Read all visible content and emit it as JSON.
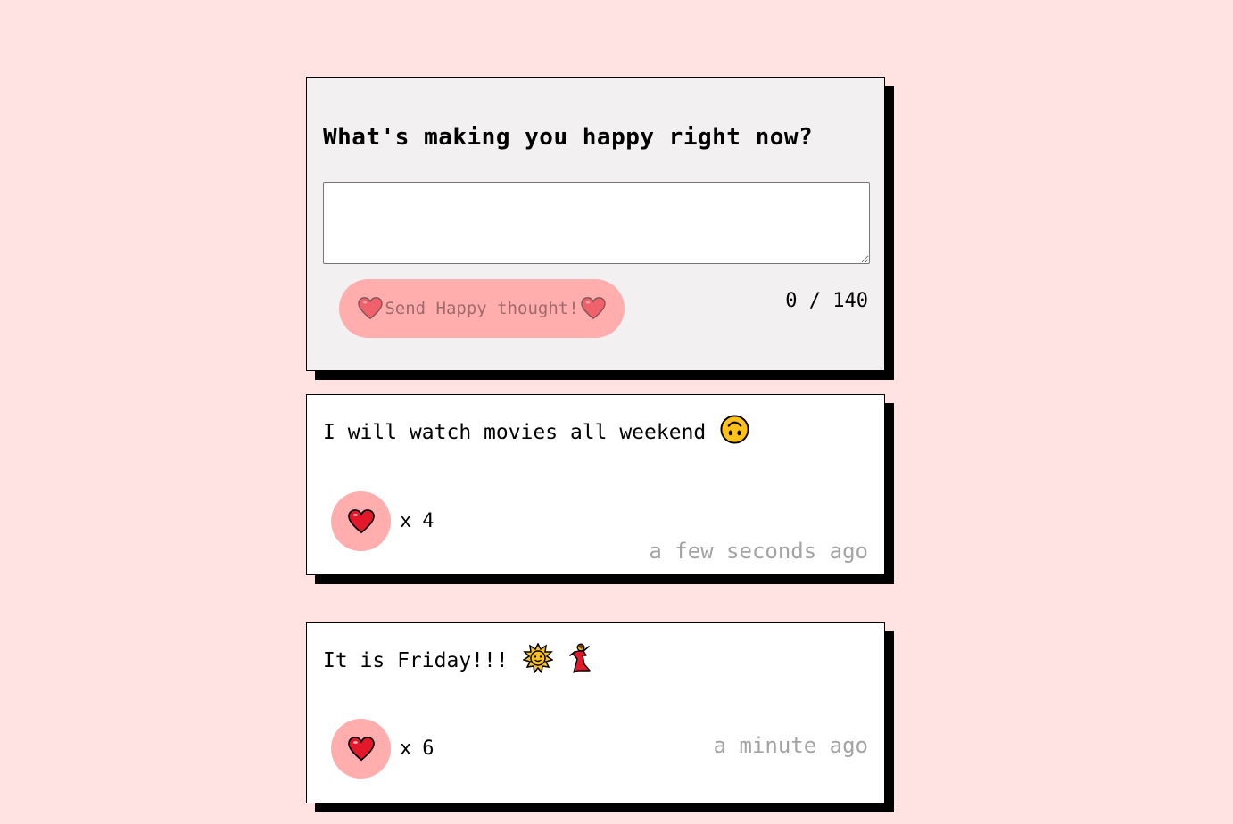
{
  "form": {
    "title": "What's making you happy right now?",
    "input_value": "",
    "send_label": "Send Happy thought!",
    "char_count": "0 / 140"
  },
  "thoughts": [
    {
      "message": "I will watch movies all weekend",
      "emoji": [
        "upside-down-face"
      ],
      "like_prefix": "x",
      "likes": "4",
      "time": "a few seconds ago"
    },
    {
      "message": "It is Friday!!!",
      "emoji": [
        "sun-with-face",
        "woman-dancing"
      ],
      "like_prefix": "x",
      "likes": "6",
      "time": "a minute ago"
    }
  ],
  "icons": {
    "send_left": "heart-icon",
    "send_right": "heart-icon",
    "like": "heart-icon"
  },
  "colors": {
    "background": "#ffe2e1",
    "form_background": "#f2f0f0",
    "button_pink": "#ffadad",
    "heart_red": "#e3192b",
    "timestamp_gray": "#a3a3a3"
  }
}
